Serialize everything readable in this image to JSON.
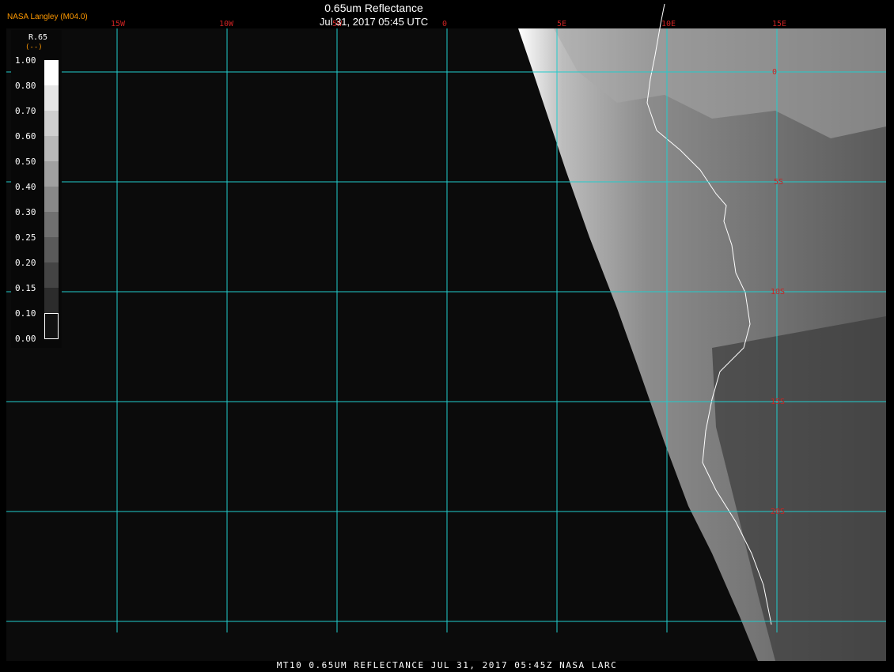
{
  "header": {
    "title": "0.65um Reflectance",
    "subtitle": "Jul 31, 2017 05:45 UTC",
    "org": "NASA Langley (M04.0)"
  },
  "footer": {
    "text": "MT10  0.65UM REFLECTANCE   JUL 31, 2017 05:45Z   NASA LARC"
  },
  "legend": {
    "title": "R.65",
    "unit": "(--)",
    "ticks": [
      "1.00",
      "0.80",
      "0.70",
      "0.60",
      "0.50",
      "0.40",
      "0.30",
      "0.25",
      "0.20",
      "0.15",
      "0.10",
      "0.00"
    ]
  },
  "grid": {
    "lon_labels": [
      "15W",
      "10W",
      "5W",
      "0",
      "5E",
      "10E",
      "15E"
    ],
    "lat_labels": [
      "0",
      "5S",
      "10S",
      "15S",
      "20S"
    ]
  },
  "colors": {
    "grid": "#22cccc",
    "label": "#cc2222",
    "org": "#ff9900",
    "coast": "#ffffff"
  }
}
